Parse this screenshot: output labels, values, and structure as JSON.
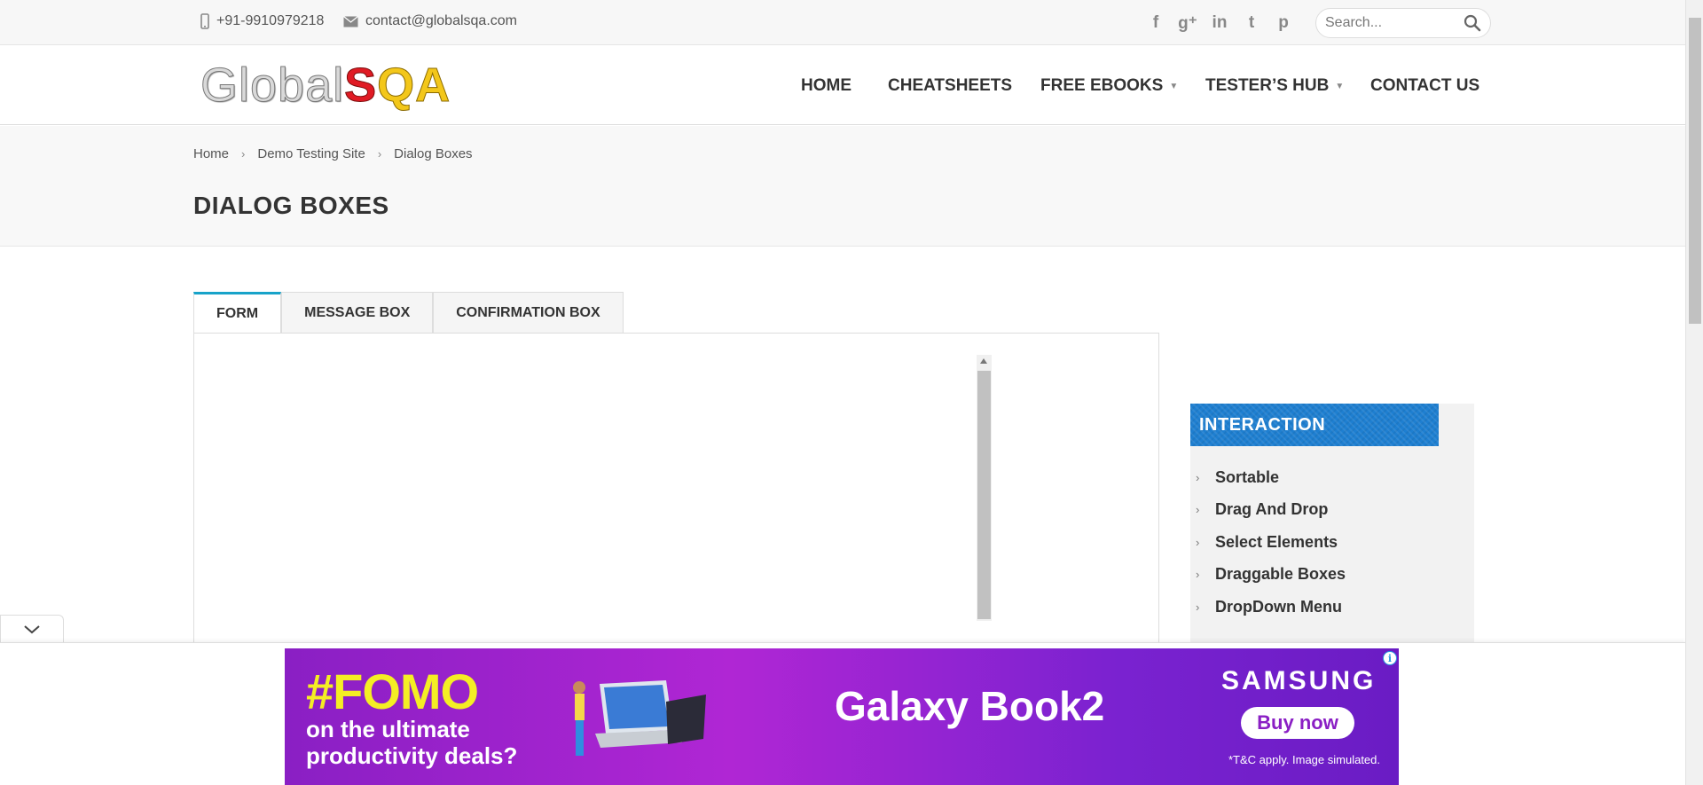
{
  "topbar": {
    "phone": "+91-9910979218",
    "email": "contact@globalsqa.com",
    "social_icons": [
      "facebook-icon",
      "google-plus-icon",
      "linkedin-icon",
      "twitter-icon",
      "pinterest-icon"
    ],
    "social_glyphs": [
      "f",
      "g⁺",
      "in",
      "t",
      "p"
    ],
    "search_placeholder": "Search..."
  },
  "header": {
    "logo": {
      "part1": "Global",
      "part2": "S",
      "part3": "QA"
    },
    "nav": [
      {
        "label": "HOME",
        "has_menu": false
      },
      {
        "label": "CHEATSHEETS",
        "has_menu": false
      },
      {
        "label": "FREE EBOOKS",
        "has_menu": true
      },
      {
        "label": "TESTER’S HUB",
        "has_menu": true
      },
      {
        "label": "CONTACT US",
        "has_menu": false
      }
    ]
  },
  "breadcrumb": [
    "Home",
    "Demo Testing Site",
    "Dialog Boxes"
  ],
  "page_title": "DIALOG BOXES",
  "tabs": [
    {
      "label": "FORM",
      "active": true
    },
    {
      "label": "MESSAGE BOX",
      "active": false
    },
    {
      "label": "CONFIRMATION BOX",
      "active": false
    }
  ],
  "sidebar": {
    "heading": "INTERACTION",
    "items": [
      "Sortable",
      "Drag And Drop",
      "Select Elements",
      "Draggable Boxes",
      "DropDown Menu"
    ]
  },
  "ad": {
    "headline": "#FOMO",
    "tagline_1": "on the ultimate",
    "tagline_2": "productivity deals?",
    "product": "Galaxy Book2",
    "brand": "SAMSUNG",
    "cta": "Buy now",
    "note": "*T&C apply. Image simulated.",
    "info": "i"
  },
  "colors": {
    "accent_tab": "#17a3c9",
    "sidebar_header": "#1e7fd1",
    "ad_background": "#8a1fc4",
    "ad_headline": "#f4ee24"
  }
}
